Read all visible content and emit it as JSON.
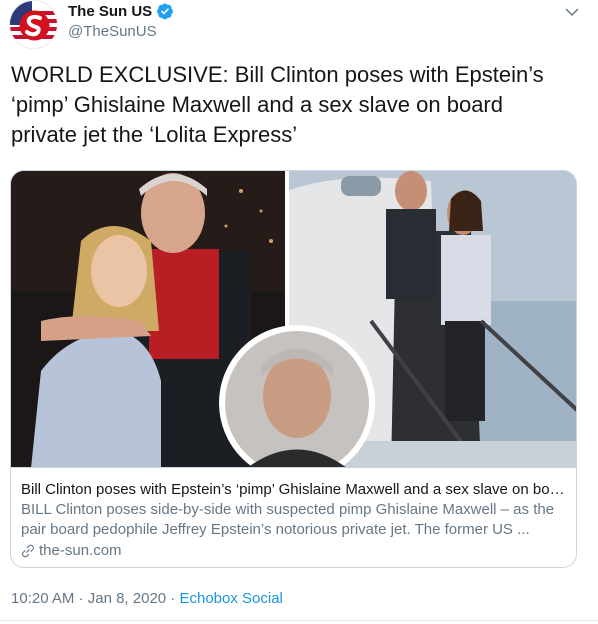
{
  "author": {
    "display_name": "The Sun US",
    "handle": "@TheSunUS",
    "verified": true,
    "avatar_icon": "the-sun-logo-icon"
  },
  "tweet": {
    "text": "WORLD EXCLUSIVE: Bill Clinton poses with Epstein’s ‘pimp’ Ghislaine Maxwell and a sex slave on board private jet the ‘Lolita Express’"
  },
  "card": {
    "title": "Bill Clinton poses with Epstein’s ‘pimp’ Ghislaine Maxwell and a sex slave on boar...",
    "description": "BILL Clinton poses side-by-side with suspected pimp Ghislaine Maxwell – as the pair board pedophile Jeffrey Epstein’s notorious private jet. The former US ...",
    "domain": "the-sun.com",
    "link_icon": "link-icon"
  },
  "meta": {
    "time": "10:20 AM",
    "separator": " · ",
    "date": "Jan 8, 2020",
    "source_separator": " · ",
    "source": "Echobox Social"
  },
  "colors": {
    "verified_blue": "#1da1f2",
    "link_blue": "#1b95e0",
    "secondary_text": "#657786",
    "border": "#ccd6dd"
  }
}
